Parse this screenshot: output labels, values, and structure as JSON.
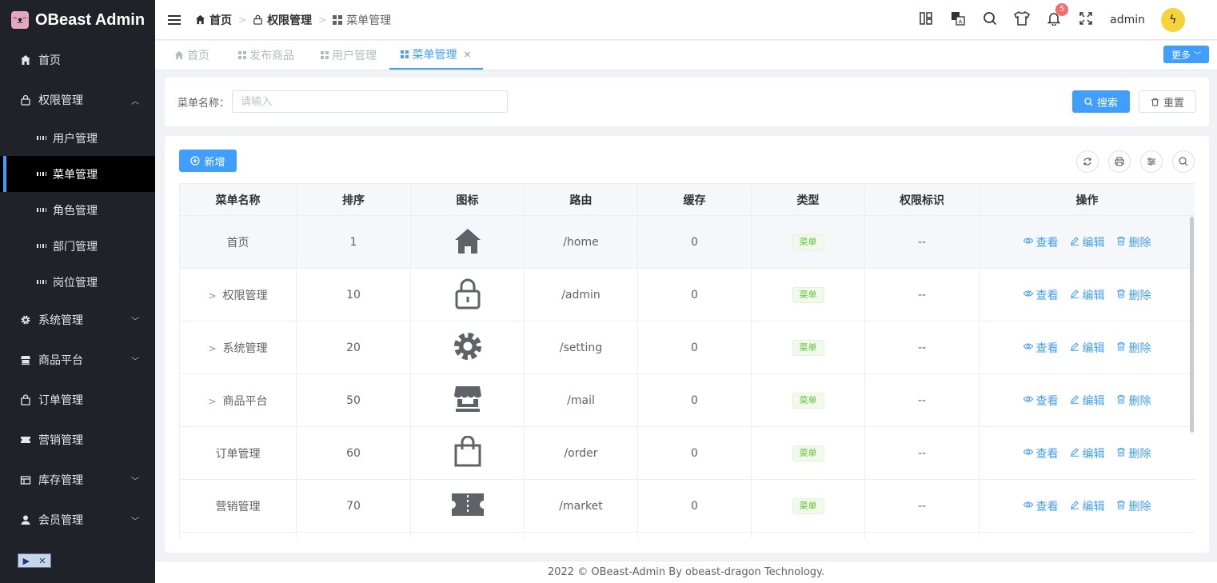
{
  "sidebar": {
    "logo_text": "OBeast Admin",
    "items": [
      {
        "label": "首页",
        "icon": "home-icon"
      },
      {
        "label": "权限管理",
        "icon": "lock-icon",
        "expanded": true
      },
      {
        "label": "系统管理",
        "icon": "gear-icon"
      },
      {
        "label": "商品平台",
        "icon": "shop-icon"
      },
      {
        "label": "订单管理",
        "icon": "bag-icon"
      },
      {
        "label": "营销管理",
        "icon": "ticket-icon"
      },
      {
        "label": "库存管理",
        "icon": "box-icon"
      },
      {
        "label": "会员管理",
        "icon": "user-icon"
      }
    ],
    "sub_items": [
      {
        "label": "用户管理"
      },
      {
        "label": "菜单管理",
        "active": true
      },
      {
        "label": "角色管理"
      },
      {
        "label": "部门管理"
      },
      {
        "label": "岗位管理"
      }
    ]
  },
  "header": {
    "breadcrumb": [
      "首页",
      "权限管理",
      "菜单管理"
    ],
    "notification_count": "5",
    "username": "admin"
  },
  "tabs": {
    "items": [
      {
        "label": "首页"
      },
      {
        "label": "发布商品"
      },
      {
        "label": "用户管理"
      },
      {
        "label": "菜单管理",
        "active": true
      }
    ],
    "close": "×",
    "more_label": "更多"
  },
  "search": {
    "label": "菜单名称：",
    "placeholder": "请输入",
    "search_label": "搜索",
    "reset_label": "重置"
  },
  "toolbar": {
    "add_label": "新增"
  },
  "table": {
    "columns": [
      "菜单名称",
      "排序",
      "图标",
      "路由",
      "缓存",
      "类型",
      "权限标识",
      "操作"
    ],
    "rows": [
      {
        "name": "首页",
        "order": "1",
        "icon": "home-icon",
        "route": "/home",
        "cache": "0",
        "type": "菜单",
        "perm": "--",
        "expandable": false
      },
      {
        "name": "权限管理",
        "order": "10",
        "icon": "lock-icon",
        "route": "/admin",
        "cache": "0",
        "type": "菜单",
        "perm": "--",
        "expandable": true
      },
      {
        "name": "系统管理",
        "order": "20",
        "icon": "gear-icon",
        "route": "/setting",
        "cache": "0",
        "type": "菜单",
        "perm": "--",
        "expandable": true
      },
      {
        "name": "商品平台",
        "order": "50",
        "icon": "shop-icon",
        "route": "/mail",
        "cache": "0",
        "type": "菜单",
        "perm": "--",
        "expandable": true
      },
      {
        "name": "订单管理",
        "order": "60",
        "icon": "bag-icon",
        "route": "/order",
        "cache": "0",
        "type": "菜单",
        "perm": "--",
        "expandable": false
      },
      {
        "name": "营销管理",
        "order": "70",
        "icon": "ticket-icon",
        "route": "/market",
        "cache": "0",
        "type": "菜单",
        "perm": "--",
        "expandable": false
      }
    ],
    "ops": {
      "view": "查看",
      "edit": "编辑",
      "delete": "删除"
    }
  },
  "footer": {
    "text": "2022 © OBeast-Admin By obeast-dragon Technology."
  },
  "colors": {
    "accent": "#409eff",
    "sidebar_bg": "#1f2329",
    "tag_green": "#67c23a",
    "badge_red": "#f56c6c"
  }
}
